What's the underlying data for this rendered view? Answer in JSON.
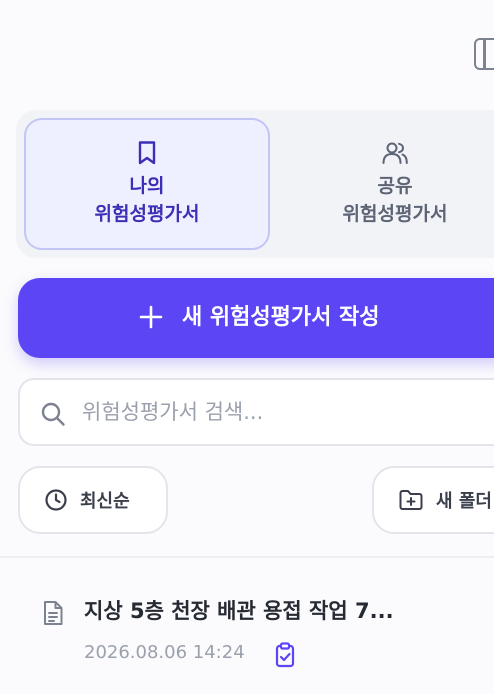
{
  "tabs": {
    "mine": {
      "line1": "나의",
      "line2": "위험성평가서"
    },
    "shared": {
      "line1": "공유",
      "line2": "위험성평가서"
    }
  },
  "create_button": {
    "label": "새 위험성평가서 작성"
  },
  "search": {
    "placeholder": "위험성평가서 검색..."
  },
  "filters": {
    "sort_label": "최신순",
    "new_folder_label": "새 폴더"
  },
  "documents": [
    {
      "title": "지상 5층 천장 배관 용접 작업 7...",
      "date": "2026.08.06 14:24"
    }
  ],
  "colors": {
    "accent": "#5b45f5",
    "active_tab_text": "#3c2fb5",
    "active_tab_bg": "#eef0ff"
  },
  "icons": {
    "sidebar_toggle": "panel-toggle-icon",
    "mine_tab": "bookmark-icon",
    "shared_tab": "users-icon",
    "create": "plus-icon",
    "search": "search-icon",
    "sort": "clock-icon",
    "new_folder": "folder-plus-icon",
    "document": "document-icon",
    "status": "clipboard-check-icon"
  }
}
